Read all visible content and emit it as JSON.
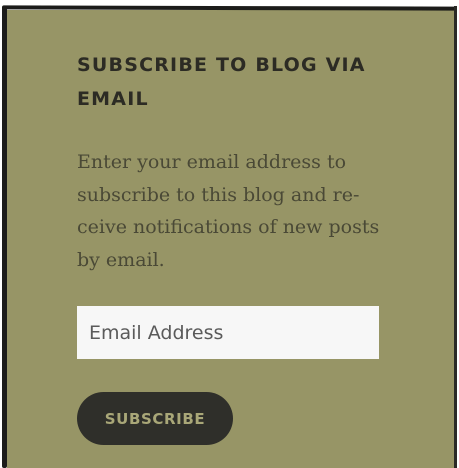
{
  "widget": {
    "title": "SUBSCRIBE TO BLOG VIA EMAIL",
    "description": "Enter your email address to subscribe to this blog and re­ceive notifications of new posts by email.",
    "email_placeholder": "Email Address",
    "email_value": "",
    "subscribe_label": "SUBSCRIBE"
  },
  "colors": {
    "widget_background": "#979566",
    "title_text": "#2c2b24",
    "body_text": "#4a4936",
    "input_background": "#f7f7f7",
    "button_background": "#2f2f2a",
    "button_text": "#a9a778"
  }
}
